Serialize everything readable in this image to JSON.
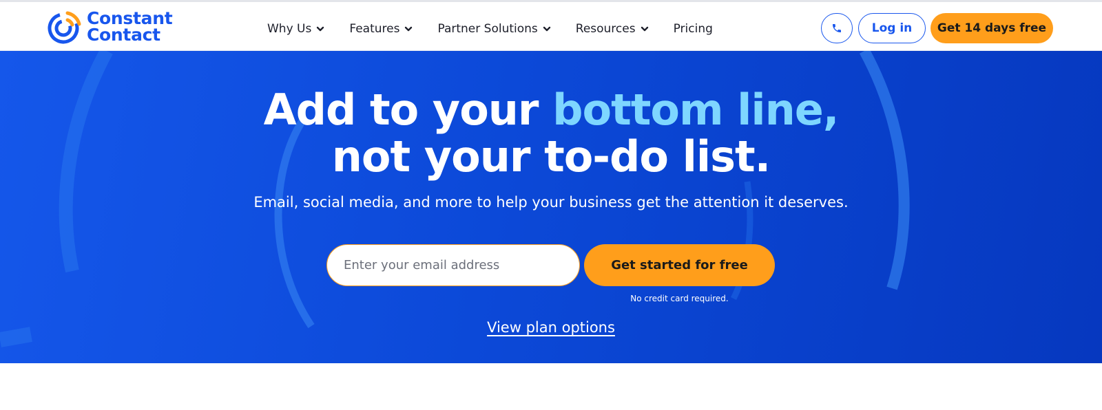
{
  "header": {
    "logo": {
      "line1": "Constant",
      "line2": "Contact",
      "icon": "constant-contact-logo-icon"
    },
    "nav": [
      {
        "label": "Why Us",
        "has_dropdown": true
      },
      {
        "label": "Features",
        "has_dropdown": true
      },
      {
        "label": "Partner Solutions",
        "has_dropdown": true
      },
      {
        "label": "Resources",
        "has_dropdown": true
      },
      {
        "label": "Pricing",
        "has_dropdown": false
      }
    ],
    "phone_icon": "phone-icon",
    "login_label": "Log in",
    "trial_label": "Get 14 days free"
  },
  "hero": {
    "headline_part1": "Add to your ",
    "headline_accent": "bottom line,",
    "headline_line2": "not your to-do list.",
    "subheadline": "Email, social media, and more to help your business get the attention it deserves.",
    "email_placeholder": "Enter your email address",
    "cta_label": "Get started for free",
    "cta_note": "No credit card required.",
    "plan_link": "View plan options"
  },
  "colors": {
    "brand_blue": "#1856ed",
    "orange": "#ff9e1b",
    "accent_light_blue": "#7ed6ff",
    "hero_blue": "#0c49d8"
  }
}
